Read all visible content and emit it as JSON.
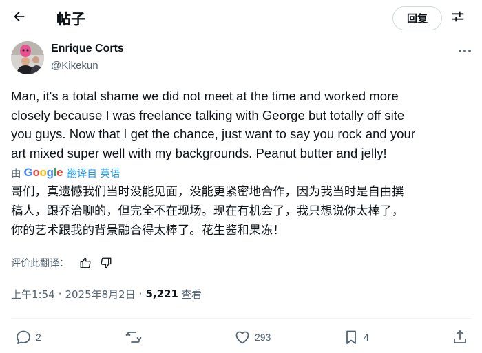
{
  "header": {
    "title": "帖子",
    "reply_label": "回复",
    "back_icon": "arrow-left-icon",
    "settings_icon": "sliders-icon"
  },
  "author": {
    "name": "Enrique Corts",
    "handle": "@Kikekun"
  },
  "tweet": {
    "lines": [
      "Man, it's a total shame we did not meet at the time and worked more",
      "closely because I was freelance talking with George but totally off site",
      "you guys. Now that I get the chance, just want to say you rock and your",
      "art mixed super well with my backgrounds. Peanut butter and jelly!"
    ]
  },
  "translation": {
    "by_label": "由",
    "provider": "Google",
    "link_label": "翻译自 英语",
    "lines": [
      "哥们，真遗憾我们当时没能见面，没能更紧密地合作，因为我当时是自由撰",
      "稿人，跟乔治聊的，但完全不在现场。现在有机会了，我只想说你太棒了，",
      "你的艺术跟我的背景融合得太棒了。花生酱和果冻！"
    ],
    "rate_label": "评价此翻译："
  },
  "meta": {
    "time": "上午1:54",
    "separator": "·",
    "date": "2025年8月2日",
    "views_count": "5,221",
    "views_label": "查看"
  },
  "actions": {
    "replies": "2",
    "likes": "293",
    "bookmarks": "4"
  },
  "colors": {
    "text": "#0f1419",
    "secondary": "#536471",
    "link": "#1d9bf0",
    "border": "#cfd9de",
    "google_blue": "#4285f4",
    "google_red": "#ea4335",
    "google_yellow": "#fbbc05",
    "google_green": "#34a853"
  }
}
